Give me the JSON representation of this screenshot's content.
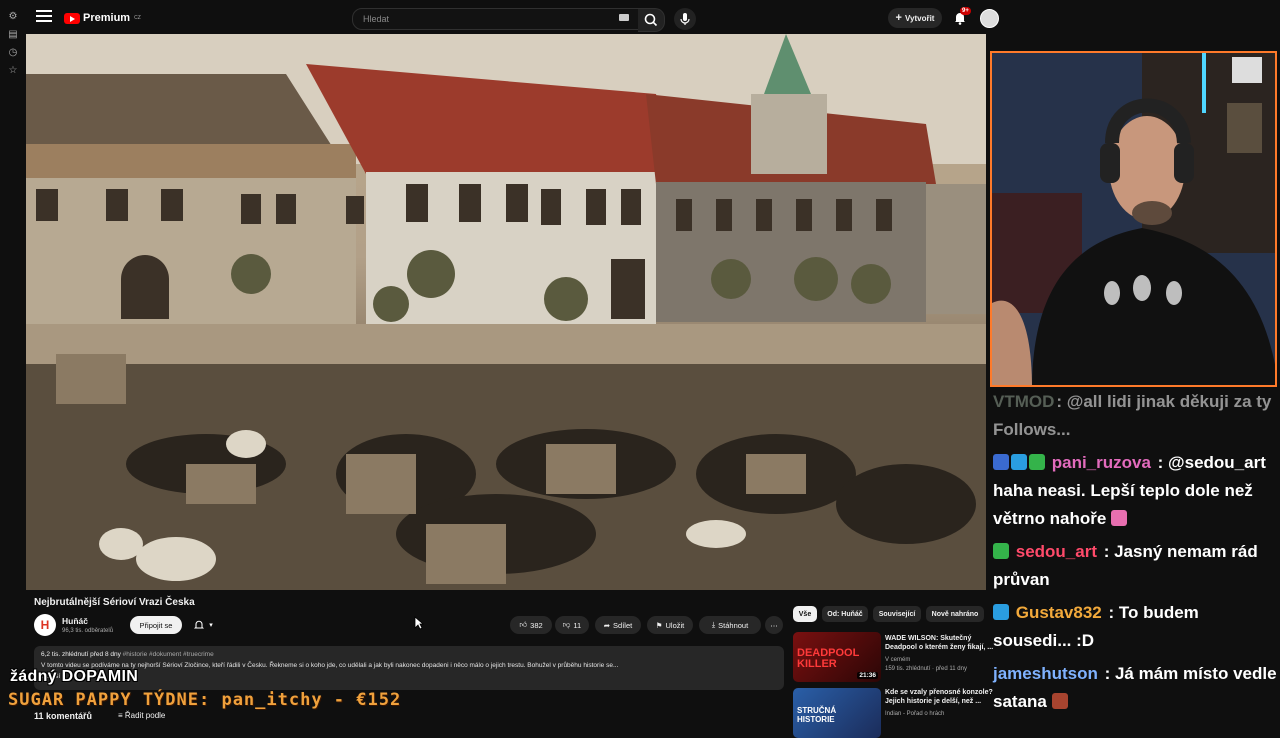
{
  "topbar": {
    "logo_text": "Premium",
    "logo_region": "CZ",
    "search_placeholder": "Hledat",
    "create_label": "Vytvořit",
    "notifications_count": "9+"
  },
  "video": {
    "title": "Nejbrutálnější Sérioví Vrazi Česka",
    "channel_name": "Huňáč",
    "channel_subs": "96,3 tis. odběratelů",
    "channel_initial": "H",
    "join_label": "Připojit se",
    "likes": "382",
    "dislikes": "11",
    "share_label": "Sdílet",
    "save_label": "Uložit",
    "download_label": "Stáhnout",
    "description": {
      "views_date": "6,2 tis. zhlédnutí  před 8 dny",
      "hashtags": "#historie #dokument #truecrime",
      "text": "V tomto videu se podíváme na ty nejhorší Sérioví Zločince, kteří řádili v Česku. Řekneme si o koho jde, co udělali a jak byli nakonec dopadeni i něco málo o jejich trestu. Bohužel v průběhu historie se...",
      "more_label": "...další"
    },
    "comments_count": "11 komentářů",
    "sort_label": "Řadit podle"
  },
  "overlay": {
    "line1": "žádný DOPAMIN",
    "line2": "SUGAR PAPPY TÝDNE: pan_itchy - €152"
  },
  "sidebar_chips": [
    "Vše",
    "Od: Huňáč",
    "Související",
    "Nově nahráno"
  ],
  "recommendations": [
    {
      "title": "WADE WILSON: Skutečný Deadpool o kterém ženy fikají, ...",
      "channel": "V cemém",
      "meta": "159 tis. zhlédnutí · před 11 dny",
      "duration": "21:36",
      "thumb_text": "DEADPOOL KILLER"
    },
    {
      "title": "Kde se vzaly přenosné konzole? Jejich historie je delší, než ...",
      "channel": "Indian - Pořad o hrách",
      "meta": "",
      "duration": "",
      "thumb_text": "STRUČNÁ HISTORIE"
    }
  ],
  "chat": [
    {
      "user": "VTMOD",
      "user_color": "#8fa08f",
      "text": ": @all lidi jinak děkuji za ty Follows...",
      "faded": true
    },
    {
      "user": "pani_ruzova",
      "user_color": "#e36bbd",
      "text": " : @sedou_art haha neasi. Lepší teplo dole než větrno nahoře",
      "badges": [
        "twitch",
        "gem",
        "sub"
      ]
    },
    {
      "user": "sedou_art",
      "user_color": "#ff4a6a",
      "text": " : Jasný nemam rád průvan",
      "badges": [
        "sub"
      ]
    },
    {
      "user": "Gustav832",
      "user_color": "#f2a93b",
      "text": " : To budem sousedi... :D",
      "badges": [
        "gem"
      ]
    },
    {
      "user": "jameshutson",
      "user_color": "#7fb2ff",
      "text": " : Já mám místo vedle satana",
      "badges": []
    }
  ],
  "colors": {
    "accent_red": "#ff0000",
    "webcam_border": "#ff7a2a",
    "overlay_orange": "#f0a13c"
  }
}
